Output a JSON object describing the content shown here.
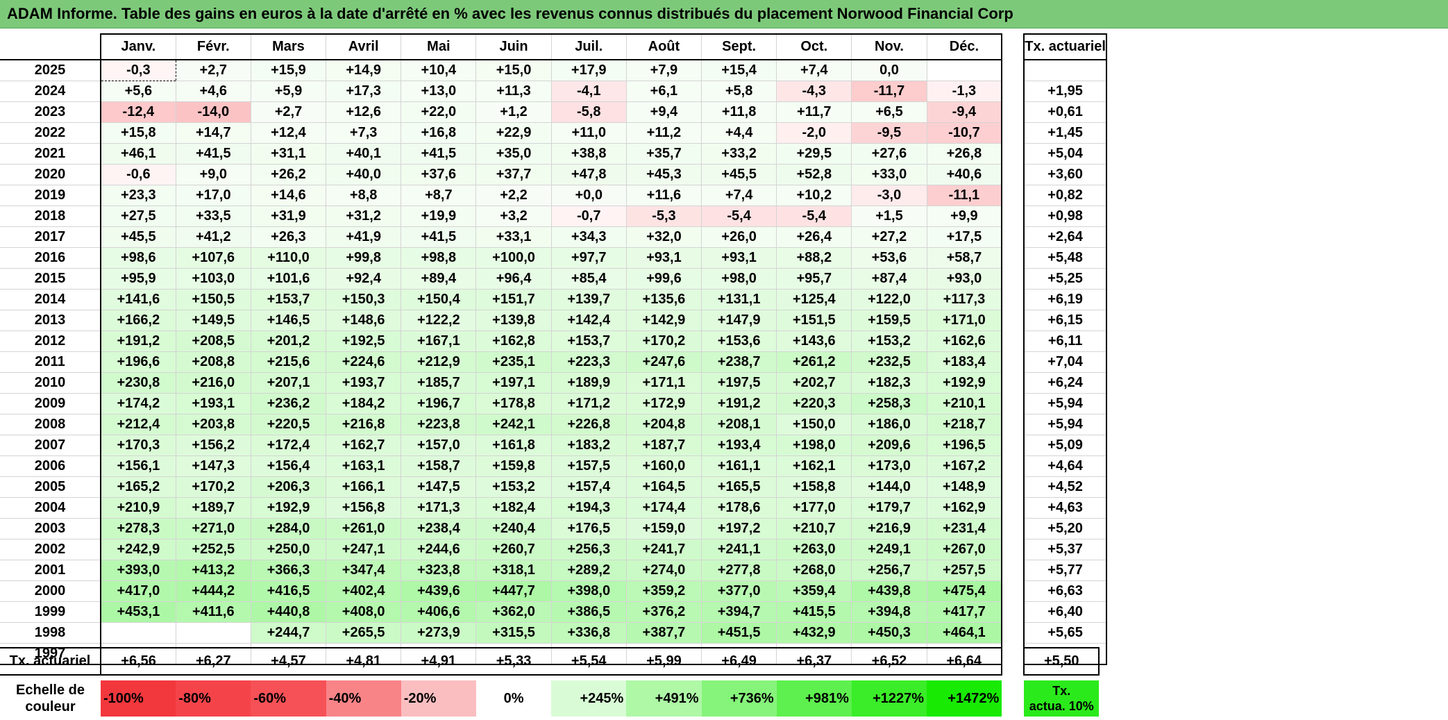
{
  "title": "ADAM Informe. Table des gains en euros à la date d'arrêté en % avec les revenus connus distribués du placement Norwood Financial Corp",
  "months": [
    "Janv.",
    "Févr.",
    "Mars",
    "Avril",
    "Mai",
    "Juin",
    "Juil.",
    "Août",
    "Sept.",
    "Oct.",
    "Nov.",
    "Déc."
  ],
  "tx_header": "Tx. actuariel",
  "rows": [
    {
      "year": "2025",
      "values": [
        "-0,3",
        "+2,7",
        "+15,9",
        "+14,9",
        "+10,4",
        "+15,0",
        "+17,9",
        "+7,9",
        "+15,4",
        "+7,4",
        "0,0",
        ""
      ],
      "tx": ""
    },
    {
      "year": "2024",
      "values": [
        "+5,6",
        "+4,6",
        "+5,9",
        "+17,3",
        "+13,0",
        "+11,3",
        "-4,1",
        "+6,1",
        "+5,8",
        "-4,3",
        "-11,7",
        "-1,3"
      ],
      "tx": "+1,95"
    },
    {
      "year": "2023",
      "values": [
        "-12,4",
        "-14,0",
        "+2,7",
        "+12,6",
        "+22,0",
        "+1,2",
        "-5,8",
        "+9,4",
        "+11,8",
        "+11,7",
        "+6,5",
        "-9,4"
      ],
      "tx": "+0,61"
    },
    {
      "year": "2022",
      "values": [
        "+15,8",
        "+14,7",
        "+12,4",
        "+7,3",
        "+16,8",
        "+22,9",
        "+11,0",
        "+11,2",
        "+4,4",
        "-2,0",
        "-9,5",
        "-10,7"
      ],
      "tx": "+1,45"
    },
    {
      "year": "2021",
      "values": [
        "+46,1",
        "+41,5",
        "+31,1",
        "+40,1",
        "+41,5",
        "+35,0",
        "+38,8",
        "+35,7",
        "+33,2",
        "+29,5",
        "+27,6",
        "+26,8"
      ],
      "tx": "+5,04"
    },
    {
      "year": "2020",
      "values": [
        "-0,6",
        "+9,0",
        "+26,2",
        "+40,0",
        "+37,6",
        "+37,7",
        "+47,8",
        "+45,3",
        "+45,5",
        "+52,8",
        "+33,0",
        "+40,6"
      ],
      "tx": "+3,60"
    },
    {
      "year": "2019",
      "values": [
        "+23,3",
        "+17,0",
        "+14,6",
        "+8,8",
        "+8,7",
        "+2,2",
        "+0,0",
        "+11,6",
        "+7,4",
        "+10,2",
        "-3,0",
        "-11,1"
      ],
      "tx": "+0,82"
    },
    {
      "year": "2018",
      "values": [
        "+27,5",
        "+33,5",
        "+31,9",
        "+31,2",
        "+19,9",
        "+3,2",
        "-0,7",
        "-5,3",
        "-5,4",
        "-5,4",
        "+1,5",
        "+9,9"
      ],
      "tx": "+0,98"
    },
    {
      "year": "2017",
      "values": [
        "+45,5",
        "+41,2",
        "+26,3",
        "+41,9",
        "+41,5",
        "+33,1",
        "+34,3",
        "+32,0",
        "+26,0",
        "+26,4",
        "+27,2",
        "+17,5"
      ],
      "tx": "+2,64"
    },
    {
      "year": "2016",
      "values": [
        "+98,6",
        "+107,6",
        "+110,0",
        "+99,8",
        "+98,8",
        "+100,0",
        "+97,7",
        "+93,1",
        "+93,1",
        "+88,2",
        "+53,6",
        "+58,7"
      ],
      "tx": "+5,48"
    },
    {
      "year": "2015",
      "values": [
        "+95,9",
        "+103,0",
        "+101,6",
        "+92,4",
        "+89,4",
        "+96,4",
        "+85,4",
        "+99,6",
        "+98,0",
        "+95,7",
        "+87,4",
        "+93,0"
      ],
      "tx": "+5,25"
    },
    {
      "year": "2014",
      "values": [
        "+141,6",
        "+150,5",
        "+153,7",
        "+150,3",
        "+150,4",
        "+151,7",
        "+139,7",
        "+135,6",
        "+131,1",
        "+125,4",
        "+122,0",
        "+117,3"
      ],
      "tx": "+6,19"
    },
    {
      "year": "2013",
      "values": [
        "+166,2",
        "+149,5",
        "+146,5",
        "+148,6",
        "+122,2",
        "+139,8",
        "+142,4",
        "+142,9",
        "+147,9",
        "+151,5",
        "+159,5",
        "+171,0"
      ],
      "tx": "+6,15"
    },
    {
      "year": "2012",
      "values": [
        "+191,2",
        "+208,5",
        "+201,2",
        "+192,5",
        "+167,1",
        "+162,8",
        "+153,7",
        "+170,2",
        "+153,6",
        "+143,6",
        "+153,2",
        "+162,6"
      ],
      "tx": "+6,11"
    },
    {
      "year": "2011",
      "values": [
        "+196,6",
        "+208,8",
        "+215,6",
        "+224,6",
        "+212,9",
        "+235,1",
        "+223,3",
        "+247,6",
        "+238,7",
        "+261,2",
        "+232,5",
        "+183,4"
      ],
      "tx": "+7,04"
    },
    {
      "year": "2010",
      "values": [
        "+230,8",
        "+216,0",
        "+207,1",
        "+193,7",
        "+185,7",
        "+197,1",
        "+189,9",
        "+171,1",
        "+197,5",
        "+202,7",
        "+182,3",
        "+192,9"
      ],
      "tx": "+6,24"
    },
    {
      "year": "2009",
      "values": [
        "+174,2",
        "+193,1",
        "+236,2",
        "+184,2",
        "+196,7",
        "+178,8",
        "+171,2",
        "+172,9",
        "+191,2",
        "+220,3",
        "+258,3",
        "+210,1"
      ],
      "tx": "+5,94"
    },
    {
      "year": "2008",
      "values": [
        "+212,4",
        "+203,8",
        "+220,5",
        "+216,8",
        "+223,8",
        "+242,1",
        "+226,8",
        "+204,8",
        "+208,1",
        "+150,0",
        "+186,0",
        "+218,7"
      ],
      "tx": "+5,94"
    },
    {
      "year": "2007",
      "values": [
        "+170,3",
        "+156,2",
        "+172,4",
        "+162,7",
        "+157,0",
        "+161,8",
        "+183,2",
        "+187,7",
        "+193,4",
        "+198,0",
        "+209,6",
        "+196,5"
      ],
      "tx": "+5,09"
    },
    {
      "year": "2006",
      "values": [
        "+156,1",
        "+147,3",
        "+156,4",
        "+163,1",
        "+158,7",
        "+159,8",
        "+157,5",
        "+160,0",
        "+161,1",
        "+162,1",
        "+173,0",
        "+167,2"
      ],
      "tx": "+4,64"
    },
    {
      "year": "2005",
      "values": [
        "+165,2",
        "+170,2",
        "+206,3",
        "+166,1",
        "+147,5",
        "+153,2",
        "+157,4",
        "+164,5",
        "+165,5",
        "+158,8",
        "+144,0",
        "+148,9"
      ],
      "tx": "+4,52"
    },
    {
      "year": "2004",
      "values": [
        "+210,9",
        "+189,7",
        "+192,9",
        "+156,8",
        "+171,3",
        "+182,4",
        "+194,3",
        "+174,4",
        "+178,6",
        "+177,0",
        "+179,7",
        "+162,9"
      ],
      "tx": "+4,63"
    },
    {
      "year": "2003",
      "values": [
        "+278,3",
        "+271,0",
        "+284,0",
        "+261,0",
        "+238,4",
        "+240,4",
        "+176,5",
        "+159,0",
        "+197,2",
        "+210,7",
        "+216,9",
        "+231,4"
      ],
      "tx": "+5,20"
    },
    {
      "year": "2002",
      "values": [
        "+242,9",
        "+252,5",
        "+250,0",
        "+247,1",
        "+244,6",
        "+260,7",
        "+256,3",
        "+241,7",
        "+241,1",
        "+263,0",
        "+249,1",
        "+267,0"
      ],
      "tx": "+5,37"
    },
    {
      "year": "2001",
      "values": [
        "+393,0",
        "+413,2",
        "+366,3",
        "+347,4",
        "+323,8",
        "+318,1",
        "+289,2",
        "+274,0",
        "+277,8",
        "+268,0",
        "+256,7",
        "+257,5"
      ],
      "tx": "+5,77"
    },
    {
      "year": "2000",
      "values": [
        "+417,0",
        "+444,2",
        "+416,5",
        "+402,4",
        "+439,6",
        "+447,7",
        "+398,0",
        "+359,2",
        "+377,0",
        "+359,4",
        "+439,8",
        "+475,4"
      ],
      "tx": "+6,63"
    },
    {
      "year": "1999",
      "values": [
        "+453,1",
        "+411,6",
        "+440,8",
        "+408,0",
        "+406,6",
        "+362,0",
        "+386,5",
        "+376,2",
        "+394,7",
        "+415,5",
        "+394,8",
        "+417,7"
      ],
      "tx": "+6,40"
    },
    {
      "year": "1998",
      "values": [
        "",
        "",
        "+244,7",
        "+265,5",
        "+273,9",
        "+315,5",
        "+336,8",
        "+387,7",
        "+451,5",
        "+432,9",
        "+450,3",
        "+464,1"
      ],
      "tx": "+5,65"
    },
    {
      "year": "1997",
      "values": [
        "",
        "",
        "",
        "",
        "",
        "",
        "",
        "",
        "",
        "",
        "",
        ""
      ],
      "tx": ""
    }
  ],
  "footer": {
    "label": "Tx. actuariel",
    "values": [
      "+6,56",
      "+6,27",
      "+4,57",
      "+4,81",
      "+4,91",
      "+5,33",
      "+5,54",
      "+5,99",
      "+6,49",
      "+6,37",
      "+6,52",
      "+6,64"
    ],
    "tx": "+5,50"
  },
  "scale": {
    "label_line1": "Echelle de",
    "label_line2": "couleur",
    "steps": [
      {
        "text": "-100%",
        "color": "#f2383d"
      },
      {
        "text": "-80%",
        "color": "#f4444a"
      },
      {
        "text": "-60%",
        "color": "#f65156"
      },
      {
        "text": "-40%",
        "color": "#f88488"
      },
      {
        "text": "-20%",
        "color": "#fbbec0"
      },
      {
        "text": "0%",
        "color": "#ffffff"
      },
      {
        "text": "+245%",
        "color": "#d9fcd6"
      },
      {
        "text": "+491%",
        "color": "#aef8a6"
      },
      {
        "text": "+736%",
        "color": "#86f47b"
      },
      {
        "text": "+981%",
        "color": "#5ef04f"
      },
      {
        "text": "+1227%",
        "color": "#3aed28"
      },
      {
        "text": "+1472%",
        "color": "#18ea03"
      }
    ],
    "legend_line1": "Tx.",
    "legend_line2": "actua. 10%",
    "legend_color": "#2bea1c"
  }
}
